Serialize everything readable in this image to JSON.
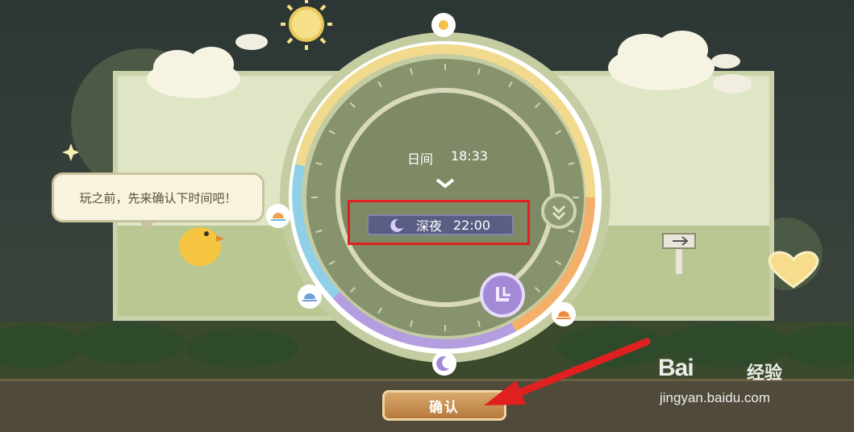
{
  "dialog": {
    "speech_bubble": "玩之前，先来确认下时间吧！",
    "current_time_label": "日间",
    "current_time_value": "18:33",
    "selected_period": "深夜",
    "selected_time": "22:00",
    "confirm_label": "确认"
  },
  "watermark": {
    "brand": "Bai",
    "brand_suffix": "经验",
    "url": "jingyan.baidu.com"
  },
  "icons": [
    "sun-icon",
    "sunrise-icon",
    "sunset-icon",
    "moon-icon",
    "skip-icon",
    "chick-icon",
    "signpost-icon",
    "heart-icon"
  ],
  "colors": {
    "highlight": "#e02020",
    "arrow": "#e02020",
    "confirm": "#c48a4a",
    "day_arc": "#f1d98e",
    "evening_arc": "#f2b06a",
    "night_arc": "#b49ee0",
    "dawn_arc": "#8fd0e8",
    "dial_inner": "#7e8a66"
  }
}
